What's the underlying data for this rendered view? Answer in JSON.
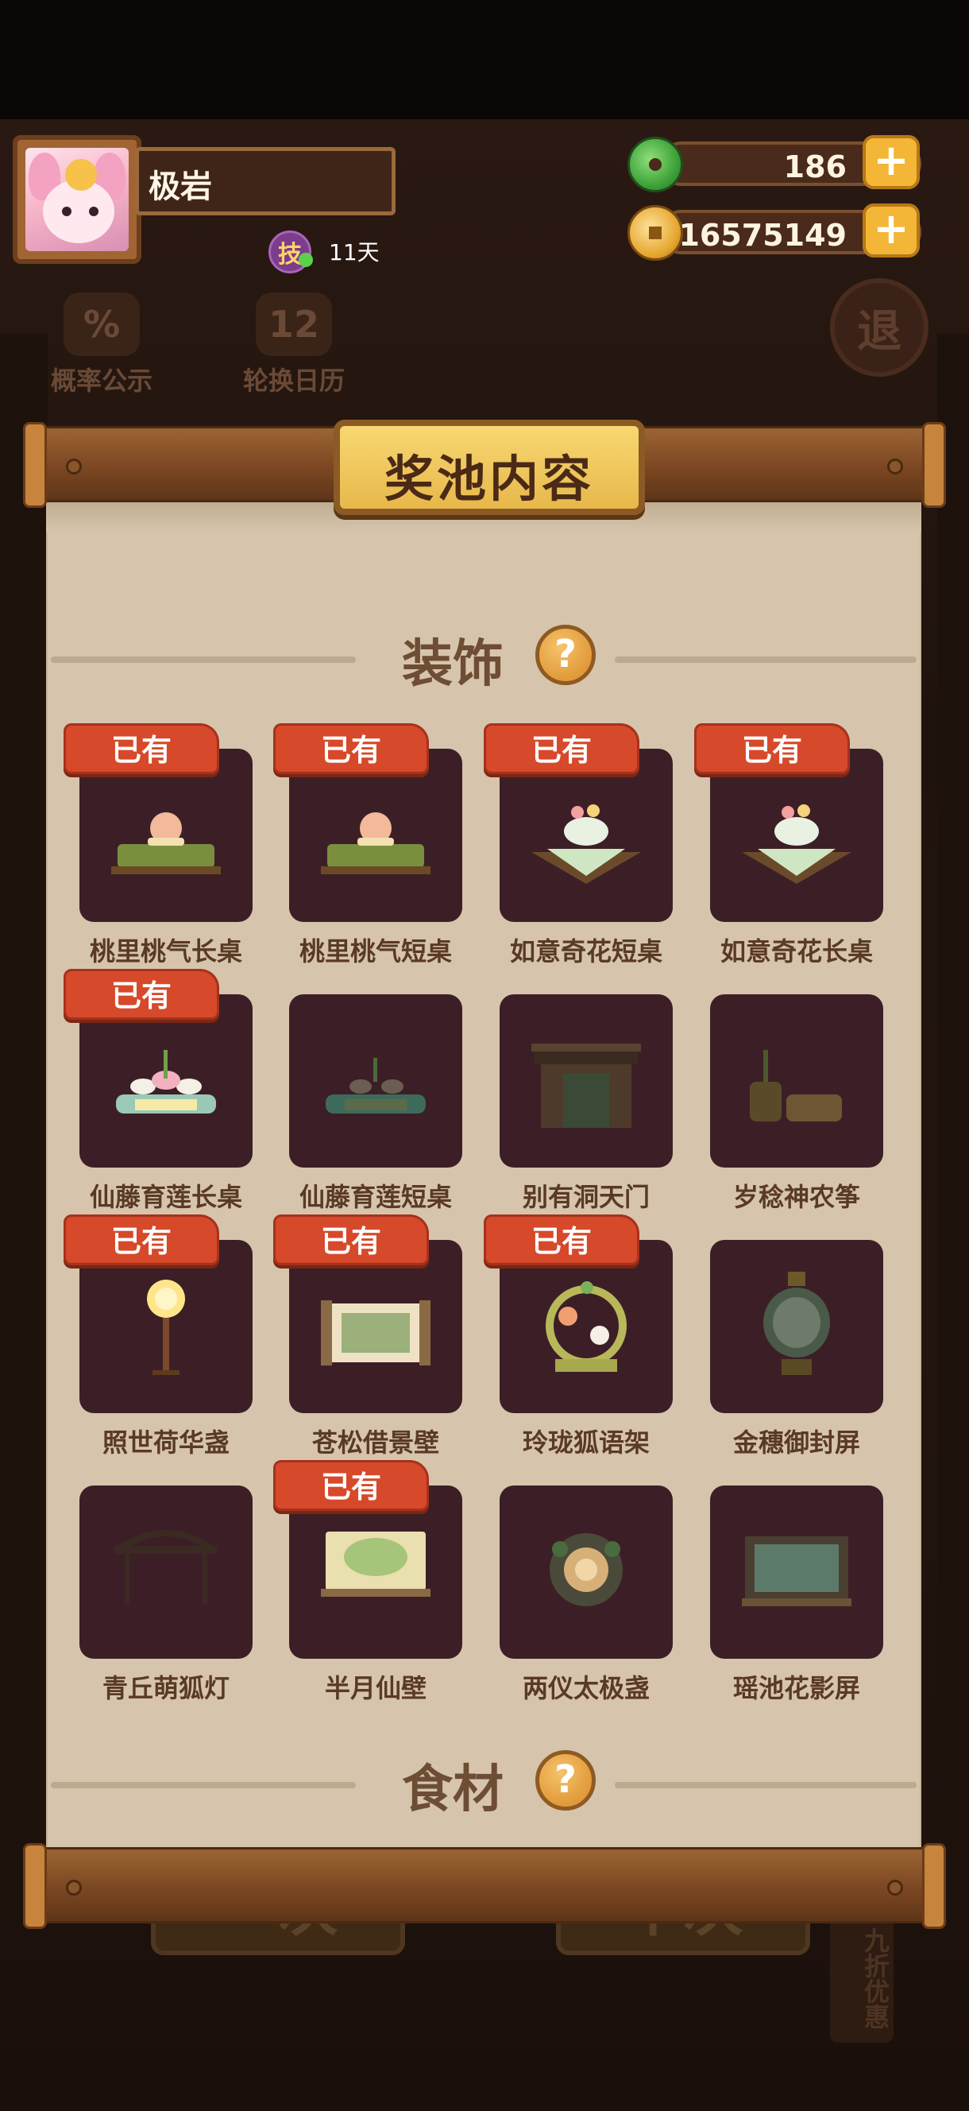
{
  "player": {
    "name": "极岩",
    "skill_badge": "技",
    "days": "11天"
  },
  "currency": {
    "jade": "186",
    "coins": "16575149",
    "plus": "+"
  },
  "background": {
    "probability": "概率公示",
    "probability_glyph": "%",
    "calendar": "轮换日历",
    "calendar_glyph": "12",
    "exit": "退",
    "single_draw": "一次",
    "ten_draw": "十次",
    "discount": "九折优惠"
  },
  "modal": {
    "title": "奖池内容",
    "section_decor": "装饰",
    "section_food": "食材",
    "help": "?",
    "owned_label": "已有",
    "items": [
      {
        "name": "桃里桃气长桌",
        "owned": true
      },
      {
        "name": "桃里桃气短桌",
        "owned": true
      },
      {
        "name": "如意奇花短桌",
        "owned": true
      },
      {
        "name": "如意奇花长桌",
        "owned": true
      },
      {
        "name": "仙藤育莲长桌",
        "owned": true
      },
      {
        "name": "仙藤育莲短桌",
        "owned": false
      },
      {
        "name": "别有洞天门",
        "owned": false
      },
      {
        "name": "岁稔神农筝",
        "owned": false
      },
      {
        "name": "照世荷华盏",
        "owned": true
      },
      {
        "name": "苍松借景壁",
        "owned": true
      },
      {
        "name": "玲珑狐语架",
        "owned": true
      },
      {
        "name": "金穗御封屏",
        "owned": false
      },
      {
        "name": "青丘萌狐灯",
        "owned": false
      },
      {
        "name": "半月仙壁",
        "owned": true
      },
      {
        "name": "两仪太极盏",
        "owned": false
      },
      {
        "name": "瑶池花影屏",
        "owned": false
      }
    ]
  },
  "colors": {
    "owned_badge": "#d6492a",
    "card_bg": "#3c1f26",
    "paper": "#d6c5ac",
    "gold": "#f3b637"
  }
}
